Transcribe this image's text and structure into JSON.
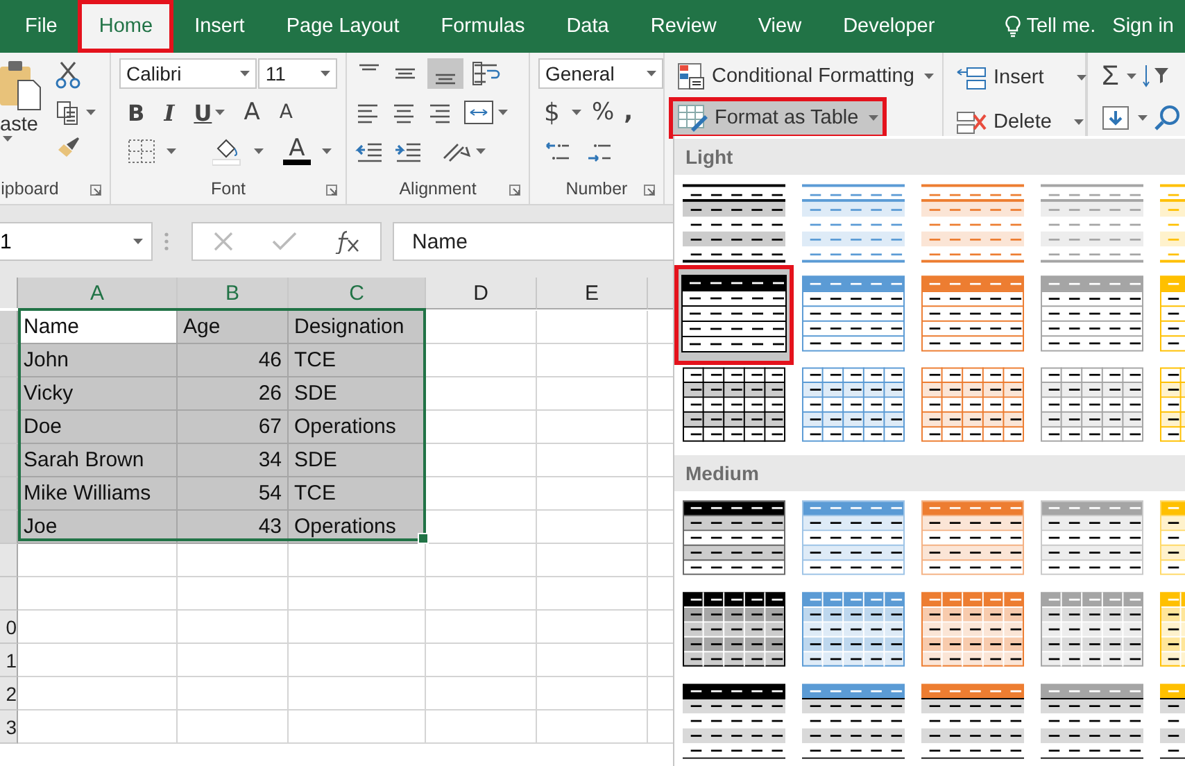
{
  "tabs": [
    {
      "label": "File",
      "selected": false,
      "annotated": false
    },
    {
      "label": "Home",
      "selected": true,
      "annotated": true
    },
    {
      "label": "Insert",
      "selected": false,
      "annotated": false
    },
    {
      "label": "Page Layout",
      "selected": false,
      "annotated": false
    },
    {
      "label": "Formulas",
      "selected": false,
      "annotated": false
    },
    {
      "label": "Data",
      "selected": false,
      "annotated": false
    },
    {
      "label": "Review",
      "selected": false,
      "annotated": false
    },
    {
      "label": "View",
      "selected": false,
      "annotated": false
    },
    {
      "label": "Developer",
      "selected": false,
      "annotated": false
    }
  ],
  "tell_me": "Tell me.",
  "sign_in": "Sign in",
  "ribbon": {
    "clipboard": {
      "paste": "aste",
      "group": "ipboard"
    },
    "font": {
      "family": "Calibri",
      "size": "11",
      "bold": "B",
      "italic": "I",
      "underline": "U",
      "grow": "A",
      "shrink": "A",
      "font_color": "A",
      "group": "Font"
    },
    "alignment": {
      "group": "Alignment"
    },
    "number": {
      "format": "General",
      "currency": "$",
      "percent": "%",
      "comma": ",",
      "group": "Number"
    },
    "styles": {
      "conditional": "Conditional Formatting",
      "format_table": "Format as Table",
      "format_table_annotated": true,
      "format_table_pressed": true
    },
    "cells": {
      "insert": "Insert",
      "delete": "Delete"
    },
    "editing": {
      "sum": "Σ"
    }
  },
  "formula_bar": {
    "name_box": "1",
    "value": "Name"
  },
  "sheet": {
    "columns": [
      {
        "label": "A",
        "selected": true,
        "numeric": false
      },
      {
        "label": "B",
        "selected": true,
        "numeric": true
      },
      {
        "label": "C",
        "selected": true,
        "numeric": false
      },
      {
        "label": "D",
        "selected": false,
        "numeric": false
      },
      {
        "label": "E",
        "selected": false,
        "numeric": false
      }
    ],
    "rows": [
      {
        "kind": "header",
        "selected": true,
        "cells": [
          "Name",
          "Age",
          "Designation"
        ]
      },
      {
        "kind": "data",
        "selected": true,
        "cells": [
          "John",
          "46",
          "TCE"
        ]
      },
      {
        "kind": "data",
        "selected": true,
        "cells": [
          "Vicky",
          "26",
          "SDE"
        ]
      },
      {
        "kind": "data",
        "selected": true,
        "cells": [
          "Doe",
          "67",
          "Operations"
        ]
      },
      {
        "kind": "data",
        "selected": true,
        "cells": [
          "Sarah Brown",
          "34",
          "SDE"
        ]
      },
      {
        "kind": "data",
        "selected": true,
        "cells": [
          "Mike Williams",
          "54",
          "TCE"
        ]
      },
      {
        "kind": "data",
        "selected": true,
        "cells": [
          "Joe",
          "43",
          "Operations"
        ]
      }
    ],
    "blank_row_numbers": [
      "0",
      "1",
      "2",
      "3"
    ]
  },
  "gallery": {
    "sections": [
      {
        "title": "Light",
        "rows": [
          {
            "kind": "light-banded",
            "swatches": [
              {
                "color": "#000000",
                "selected": false
              },
              {
                "color": "#5b9bd5",
                "selected": false
              },
              {
                "color": "#ed7d31",
                "selected": false
              },
              {
                "color": "#a5a5a5",
                "selected": false
              },
              {
                "color": "#ffc000",
                "selected": false
              }
            ]
          },
          {
            "kind": "light-header",
            "swatches": [
              {
                "color": "#000000",
                "selected": true
              },
              {
                "color": "#5b9bd5",
                "selected": false
              },
              {
                "color": "#ed7d31",
                "selected": false
              },
              {
                "color": "#a5a5a5",
                "selected": false
              },
              {
                "color": "#ffc000",
                "selected": false
              }
            ]
          },
          {
            "kind": "light-grid",
            "swatches": [
              {
                "color": "#000000",
                "selected": false
              },
              {
                "color": "#5b9bd5",
                "selected": false
              },
              {
                "color": "#ed7d31",
                "selected": false
              },
              {
                "color": "#a5a5a5",
                "selected": false
              },
              {
                "color": "#ffc000",
                "selected": false
              }
            ]
          }
        ]
      },
      {
        "title": "Medium",
        "rows": [
          {
            "kind": "medium-banded",
            "swatches": [
              {
                "color": "#000000",
                "selected": false
              },
              {
                "color": "#5b9bd5",
                "selected": false
              },
              {
                "color": "#ed7d31",
                "selected": false
              },
              {
                "color": "#a5a5a5",
                "selected": false
              },
              {
                "color": "#ffc000",
                "selected": false
              }
            ]
          },
          {
            "kind": "medium-grid",
            "swatches": [
              {
                "color": "#000000",
                "selected": false
              },
              {
                "color": "#5b9bd5",
                "selected": false
              },
              {
                "color": "#ed7d31",
                "selected": false
              },
              {
                "color": "#a5a5a5",
                "selected": false
              },
              {
                "color": "#ffc000",
                "selected": false
              }
            ]
          },
          {
            "kind": "medium-lines",
            "swatches": [
              {
                "color": "#000000",
                "selected": false
              },
              {
                "color": "#5b9bd5",
                "selected": false
              },
              {
                "color": "#ed7d31",
                "selected": false
              },
              {
                "color": "#a5a5a5",
                "selected": false
              },
              {
                "color": "#ffc000",
                "selected": false
              }
            ]
          }
        ]
      }
    ]
  }
}
